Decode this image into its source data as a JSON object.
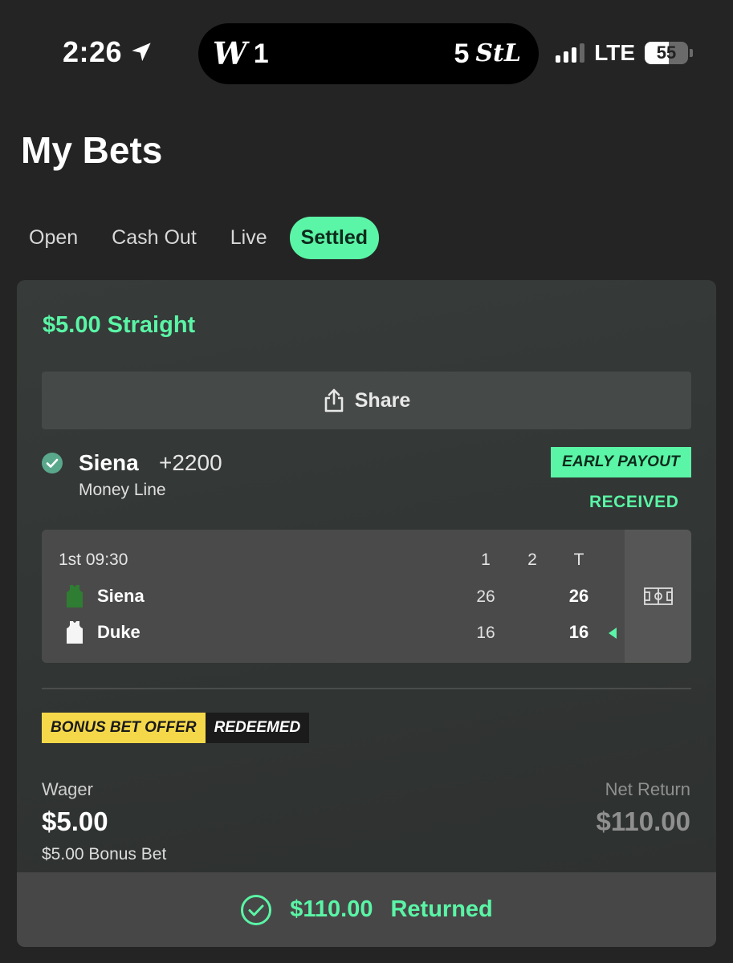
{
  "status_bar": {
    "time": "2:26",
    "carrier": "LTE",
    "battery": "55",
    "live_activity": {
      "away_logo": "W",
      "away_score": "1",
      "home_score": "5",
      "home_logo": "StL"
    }
  },
  "header": {
    "title": "My Bets"
  },
  "tabs": [
    {
      "label": "Open",
      "active": false
    },
    {
      "label": "Cash Out",
      "active": false
    },
    {
      "label": "Live",
      "active": false
    },
    {
      "label": "Settled",
      "active": true
    }
  ],
  "bet": {
    "title": "$5.00 Straight",
    "share_label": "Share",
    "selection": {
      "team": "Siena",
      "odds": "+2200",
      "market": "Money Line",
      "badge": "EARLY PAYOUT",
      "badge_status": "RECEIVED"
    },
    "scoreboard": {
      "clock": "1st 09:30",
      "headers": [
        "1",
        "2",
        "T"
      ],
      "teams": [
        {
          "name": "Siena",
          "period1": "26",
          "period2": "",
          "total": "26",
          "jersey_color": "#2e7d32"
        },
        {
          "name": "Duke",
          "period1": "16",
          "period2": "",
          "total": "16",
          "jersey_color": "#f5f5f5"
        }
      ]
    },
    "bonus_tag": {
      "label": "BONUS BET OFFER",
      "status": "REDEEMED"
    },
    "wager_label": "Wager",
    "wager_value": "$5.00",
    "wager_sub": "$5.00 Bonus Bet",
    "net_return_label": "Net Return",
    "net_return_value": "$110.00",
    "returned_amount": "$110.00",
    "returned_label": "Returned"
  },
  "colors": {
    "accent": "#5af5a6",
    "bonus_yellow": "#f5d84a",
    "background": "#242424"
  }
}
